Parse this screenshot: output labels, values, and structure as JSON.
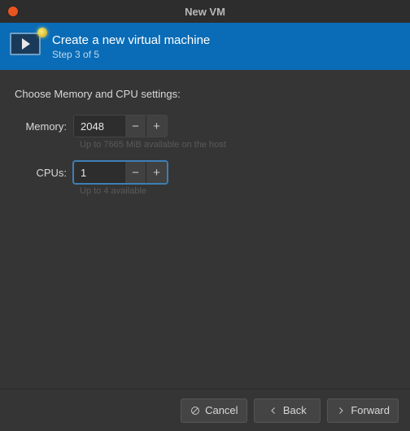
{
  "window": {
    "title": "New VM"
  },
  "header": {
    "title": "Create a new virtual machine",
    "step": "Step 3 of 5"
  },
  "body": {
    "instruction": "Choose Memory and CPU settings:",
    "memory": {
      "label": "Memory:",
      "value": "2048",
      "hint": "Up to 7665 MiB available on the host"
    },
    "cpus": {
      "label": "CPUs:",
      "value": "1",
      "hint": "Up to 4 available"
    }
  },
  "footer": {
    "cancel": "Cancel",
    "back": "Back",
    "forward": "Forward"
  }
}
